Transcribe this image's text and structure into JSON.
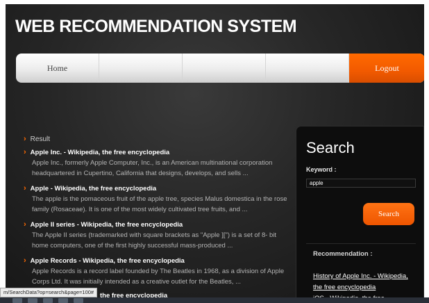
{
  "site": {
    "title": "WEB RECOMMENDATION SYSTEM"
  },
  "nav": {
    "home": "Home",
    "logout": "Logout"
  },
  "results": {
    "heading": "Result",
    "items": [
      {
        "title": "Apple Inc. - Wikipedia, the free encyclopedia",
        "desc": "Apple Inc., formerly Apple Computer, Inc., is an American multinational corporation headquartered in Cupertino, California that designs, develops, and sells ..."
      },
      {
        "title": "Apple - Wikipedia, the free encyclopedia",
        "desc": "The apple is the pomaceous fruit of the apple tree, species Malus domestica in the rose family (Rosaceae). It is one of the most widely cultivated tree fruits, and ..."
      },
      {
        "title": "Apple II series - Wikipedia, the free encyclopedia",
        "desc": "The Apple II series (trademarked with square brackets as \"Apple ][\") is a set of 8- bit home computers, one of the first highly successful mass-produced ..."
      },
      {
        "title": "Apple Records - Wikipedia, the free encyclopedia",
        "desc": "Apple Records is a record label founded by The Beatles in 1968, as a division of Apple Corps Ltd. It was initially intended as a creative outlet for the Beatles, ..."
      },
      {
        "title": "the free encyclopedia",
        "desc": ""
      }
    ]
  },
  "search": {
    "heading": "Search",
    "keyword_label": "Keyword :",
    "keyword_value": "apple",
    "button_label": "Search",
    "recommendation_heading": "Recommendation :",
    "recommendations": [
      "History of Apple Inc. - Wikipedia, the free encyclopedia",
      "iOS - Wikipedia, the free"
    ]
  },
  "status_bar": {
    "url": "m/SearchData?op=search&page=100#"
  },
  "icons": {
    "result_bullet": "chevron-right-icon"
  },
  "colors": {
    "accent": "#ff6a00",
    "background": "#262626"
  }
}
